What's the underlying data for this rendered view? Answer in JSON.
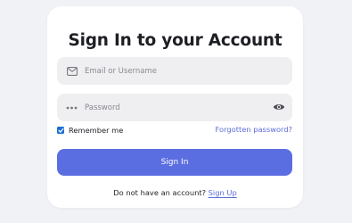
{
  "form": {
    "title": "Sign In to your Account",
    "email": {
      "placeholder": "Email or Username",
      "value": "",
      "icon": "mail-icon"
    },
    "password": {
      "placeholder": "Password",
      "value": "",
      "icon": "password-dots-icon",
      "toggle_icon": "eye-icon"
    },
    "remember": {
      "label": "Remember me",
      "checked": true
    },
    "forgot_label": "Forgotten password?",
    "submit_label": "Sign In",
    "signup_prompt": "Do not have an account?",
    "signup_label": "Sign Up"
  },
  "colors": {
    "background": "#f1f2f6",
    "card": "#ffffff",
    "field": "#efeff1",
    "primary": "#5b6ee1",
    "link": "#5b6cd9",
    "checkbox": "#1b6fd6"
  }
}
